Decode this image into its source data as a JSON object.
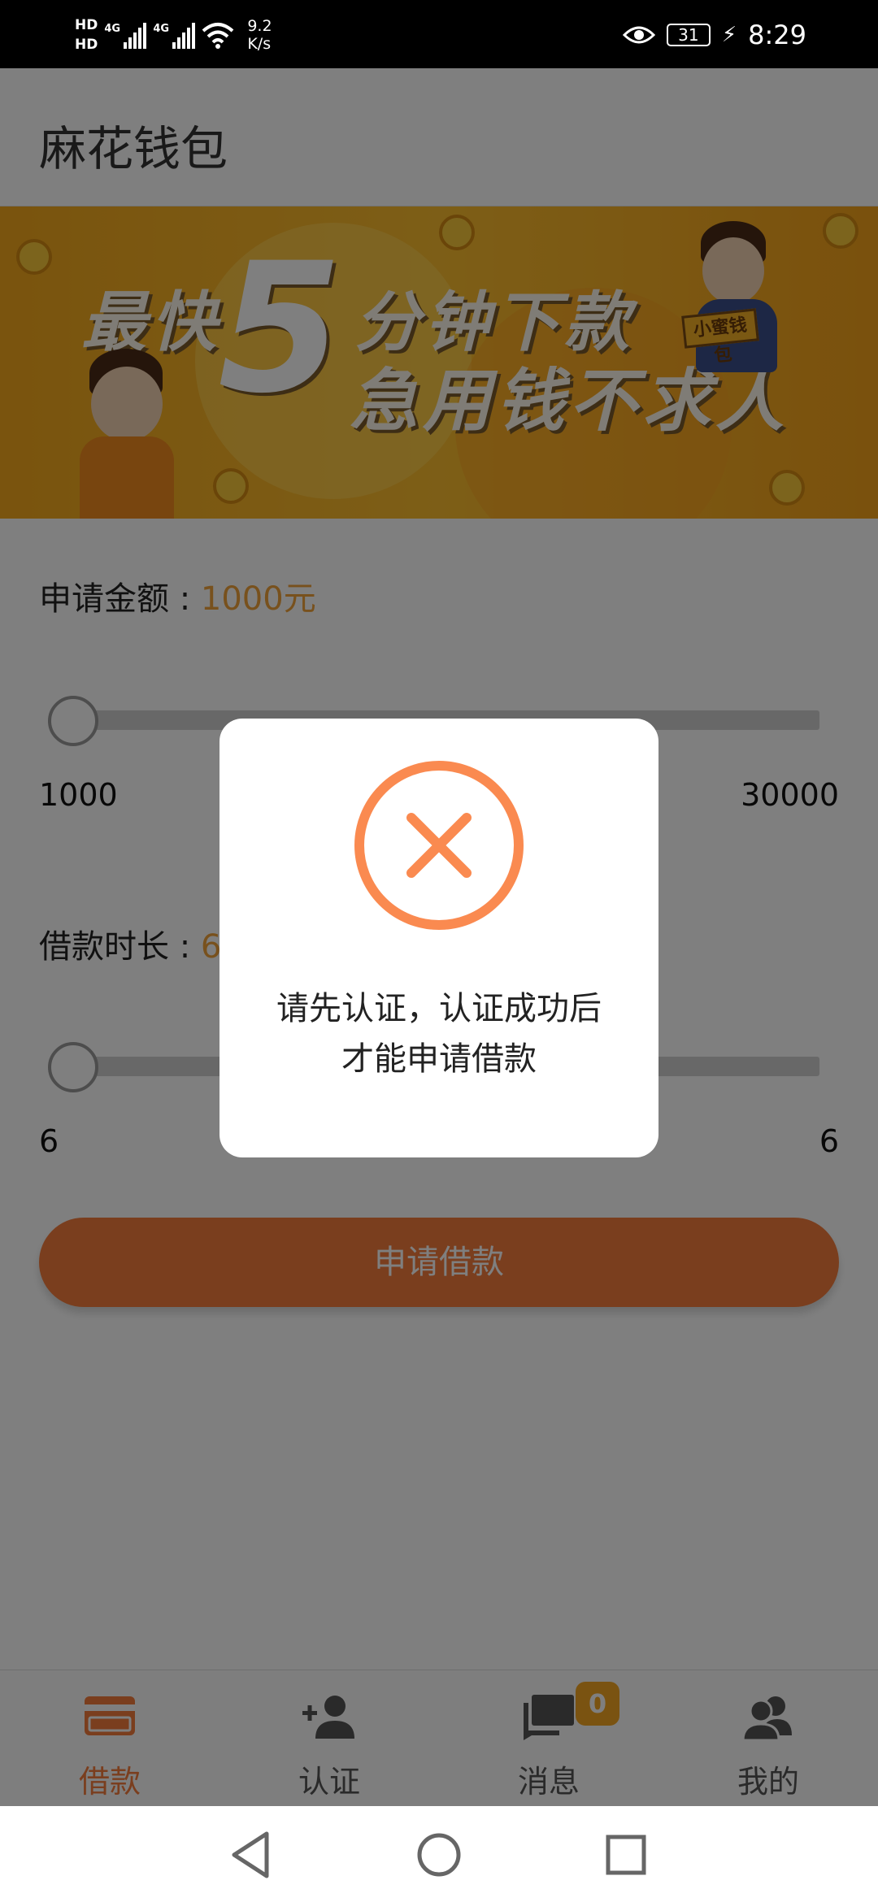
{
  "status_bar": {
    "hd1": "HD",
    "hd2": "HD",
    "net1": "4G",
    "net2": "4G",
    "speed_value": "9.2",
    "speed_unit": "K/s",
    "battery": "31",
    "time": "8:29"
  },
  "toolbar": {
    "title": "麻花钱包"
  },
  "banner": {
    "line1a": "最快",
    "big_number": "5",
    "line1b": "分钟下款",
    "line2": "急用钱不求人",
    "tag": "小蜜钱包"
  },
  "form": {
    "amount_label": "申请金额 : ",
    "amount_value": "1000元",
    "amount_min": "1000",
    "amount_max": "30000",
    "amount_slider_level": 0,
    "duration_label": "借款时长 : ",
    "duration_value": "6",
    "duration_min": "6",
    "duration_max": "6",
    "duration_slider_level": 0,
    "apply_button": "申请借款"
  },
  "dialog": {
    "icon": "close-circle-icon",
    "line1": "请先认证，认证成功后",
    "line2": "才能申请借款"
  },
  "bottom_nav": {
    "items": [
      {
        "label": "借款",
        "icon": "card-icon",
        "active": true
      },
      {
        "label": "认证",
        "icon": "add-user-icon",
        "active": false
      },
      {
        "label": "消息",
        "icon": "message-icon",
        "active": false,
        "badge": "0"
      },
      {
        "label": "我的",
        "icon": "users-icon",
        "active": false
      }
    ]
  },
  "colors": {
    "accent": "#f47c3c",
    "amount_value": "#f0a23a",
    "badge": "#f5a623",
    "status_bar": "#000000"
  }
}
